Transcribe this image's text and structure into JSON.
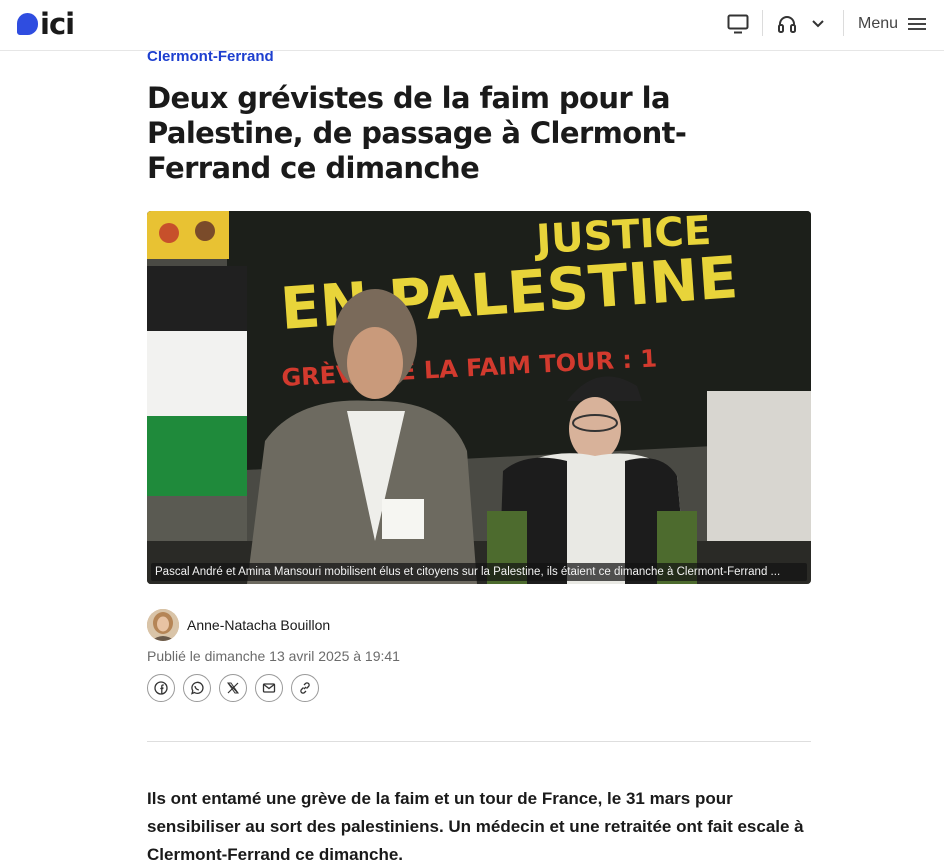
{
  "header": {
    "logo_text": "ici",
    "menu_label": "Menu",
    "icons": [
      "tv-icon",
      "headphones-icon",
      "chevron-down-icon",
      "hamburger-menu-icon"
    ]
  },
  "article": {
    "category": "Clermont-Ferrand",
    "title": "Deux grévistes de la faim pour la Palestine, de passage à Clermont-Ferrand ce dimanche",
    "photo_caption": "Pascal André et Amina Mansouri mobilisent élus et citoyens sur la Palestine, ils étaient ce dimanche à Clermont-Ferrand ...",
    "photo_banner_text": {
      "line1": "JUSTICE",
      "line2": "EN PALESTINE",
      "line3": "GRÈVE DE LA FAIM TOUR : 1"
    },
    "author": "Anne-Natacha Bouillon",
    "published": "Publié le dimanche 13 avril 2025 à 19:41",
    "share_icons": [
      "facebook-icon",
      "whatsapp-icon",
      "x-icon",
      "email-icon",
      "link-icon"
    ],
    "lead": "Ils ont entamé une grève de la faim et un tour de France, le 31 mars pour sensibiliser au sort des palestiniens. Un médecin et une retraitée ont fait escale à Clermont-Ferrand ce dimanche."
  },
  "colors": {
    "brand": "#2f4de0",
    "category": "#1d3fcf",
    "text": "#1a1a1a",
    "muted": "#6b6b6b"
  }
}
